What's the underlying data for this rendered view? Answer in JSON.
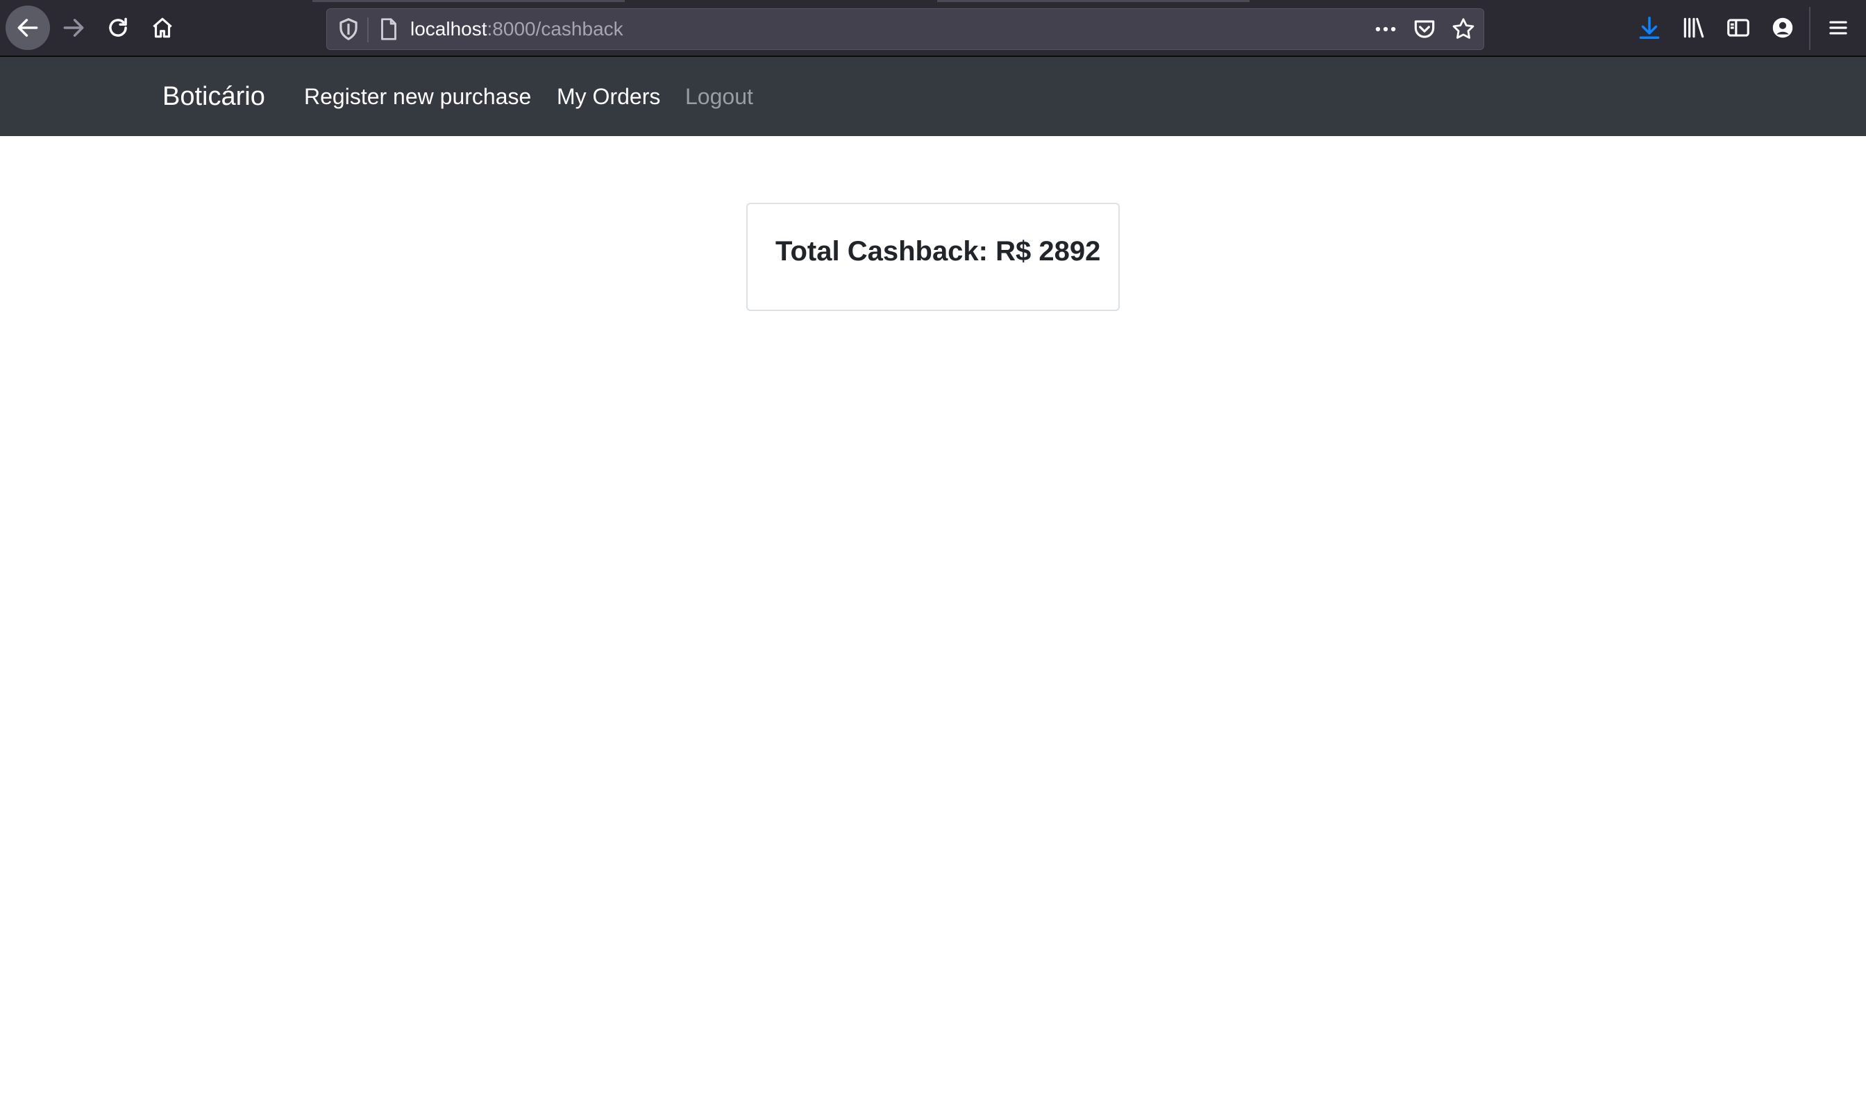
{
  "browser": {
    "url_host": "localhost",
    "url_path": ":8000/cashback",
    "icons": {
      "back": "back-arrow-icon",
      "forward": "forward-arrow-icon",
      "reload": "reload-icon",
      "home": "home-icon",
      "shield": "shield-icon",
      "page": "page-icon",
      "more": "more-dots-icon",
      "pocket": "pocket-icon",
      "bookmark": "star-icon",
      "download": "download-icon",
      "library": "library-icon",
      "sidebar": "sidebar-icon",
      "account": "account-icon",
      "menu": "hamburger-menu-icon"
    },
    "colors": {
      "toolbar": "#2b2a33",
      "download_accent": "#0a84ff"
    }
  },
  "navbar": {
    "brand": "Boticário",
    "links": [
      {
        "label": "Register new purchase"
      },
      {
        "label": "My Orders"
      },
      {
        "label": "Logout"
      }
    ],
    "colors": {
      "background": "#343a40",
      "muted_link": "#9a9da1"
    }
  },
  "main": {
    "cashback_label": "Total Cashback: R$ 2892"
  }
}
